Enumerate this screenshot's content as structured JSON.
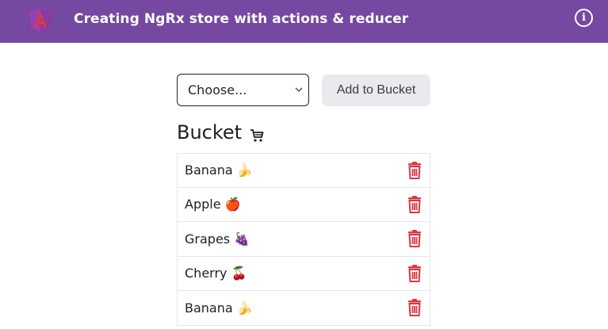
{
  "header": {
    "title": "Creating NgRx store with actions & reducer",
    "logo_icon": "angular-logo-icon",
    "info_icon": "info-icon",
    "info_glyph": "i",
    "bg_color": "#7548a1"
  },
  "form": {
    "select_value": "Choose...",
    "add_button_label": "Add to Bucket"
  },
  "bucket": {
    "heading": "Bucket",
    "heading_icon": "cart-icon",
    "items": [
      {
        "label": "Banana 🍌"
      },
      {
        "label": "Apple 🍎"
      },
      {
        "label": "Grapes 🍇"
      },
      {
        "label": "Cherry 🍒"
      },
      {
        "label": "Banana 🍌"
      }
    ],
    "delete_icon": "trash-icon",
    "delete_color": "#dc3545"
  }
}
